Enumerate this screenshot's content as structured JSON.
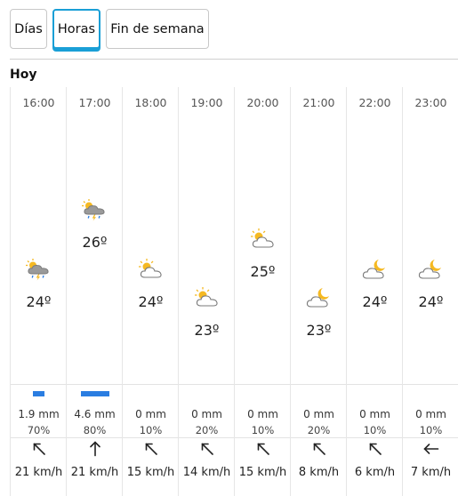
{
  "tabs": [
    {
      "label": "Días",
      "active": false
    },
    {
      "label": "Horas",
      "active": true
    },
    {
      "label": "Fin de semana",
      "active": false
    }
  ],
  "day_label": "Hoy",
  "hours": [
    {
      "time": "16:00",
      "icon": "sun-cloud-storm-icon",
      "temp": "24º",
      "rain_mm": "1.9 mm",
      "rain_pct": "70%",
      "rain_amount": 1.9,
      "wind_dir": "northwest-arrow-icon",
      "wind": "21 km/h"
    },
    {
      "time": "17:00",
      "icon": "sun-cloud-storm-icon",
      "temp": "26º",
      "rain_mm": "4.6 mm",
      "rain_pct": "80%",
      "rain_amount": 4.6,
      "wind_dir": "north-arrow-icon",
      "wind": "21 km/h"
    },
    {
      "time": "18:00",
      "icon": "sun-cloud-icon",
      "temp": "24º",
      "rain_mm": "0 mm",
      "rain_pct": "10%",
      "rain_amount": 0,
      "wind_dir": "northwest-arrow-icon",
      "wind": "15 km/h"
    },
    {
      "time": "19:00",
      "icon": "sun-cloud-icon",
      "temp": "23º",
      "rain_mm": "0 mm",
      "rain_pct": "20%",
      "rain_amount": 0,
      "wind_dir": "northwest-arrow-icon",
      "wind": "14 km/h"
    },
    {
      "time": "20:00",
      "icon": "sun-cloud-icon",
      "temp": "25º",
      "rain_mm": "0 mm",
      "rain_pct": "10%",
      "rain_amount": 0,
      "wind_dir": "northwest-arrow-icon",
      "wind": "15 km/h"
    },
    {
      "time": "21:00",
      "icon": "moon-cloud-icon",
      "temp": "23º",
      "rain_mm": "0 mm",
      "rain_pct": "20%",
      "rain_amount": 0,
      "wind_dir": "northwest-arrow-icon",
      "wind": "8 km/h"
    },
    {
      "time": "22:00",
      "icon": "moon-cloud-icon",
      "temp": "24º",
      "rain_mm": "0 mm",
      "rain_pct": "10%",
      "rain_amount": 0,
      "wind_dir": "northwest-arrow-icon",
      "wind": "6 km/h"
    },
    {
      "time": "23:00",
      "icon": "moon-cloud-icon",
      "temp": "24º",
      "rain_mm": "0 mm",
      "rain_pct": "10%",
      "rain_amount": 0,
      "wind_dir": "west-arrow-icon",
      "wind": "7 km/h"
    }
  ],
  "colors": {
    "accent": "#1a9fd6",
    "rain_bar": "#2a7de1",
    "sun": "#f5b922",
    "cloud_stroke": "#7a7a7a"
  }
}
